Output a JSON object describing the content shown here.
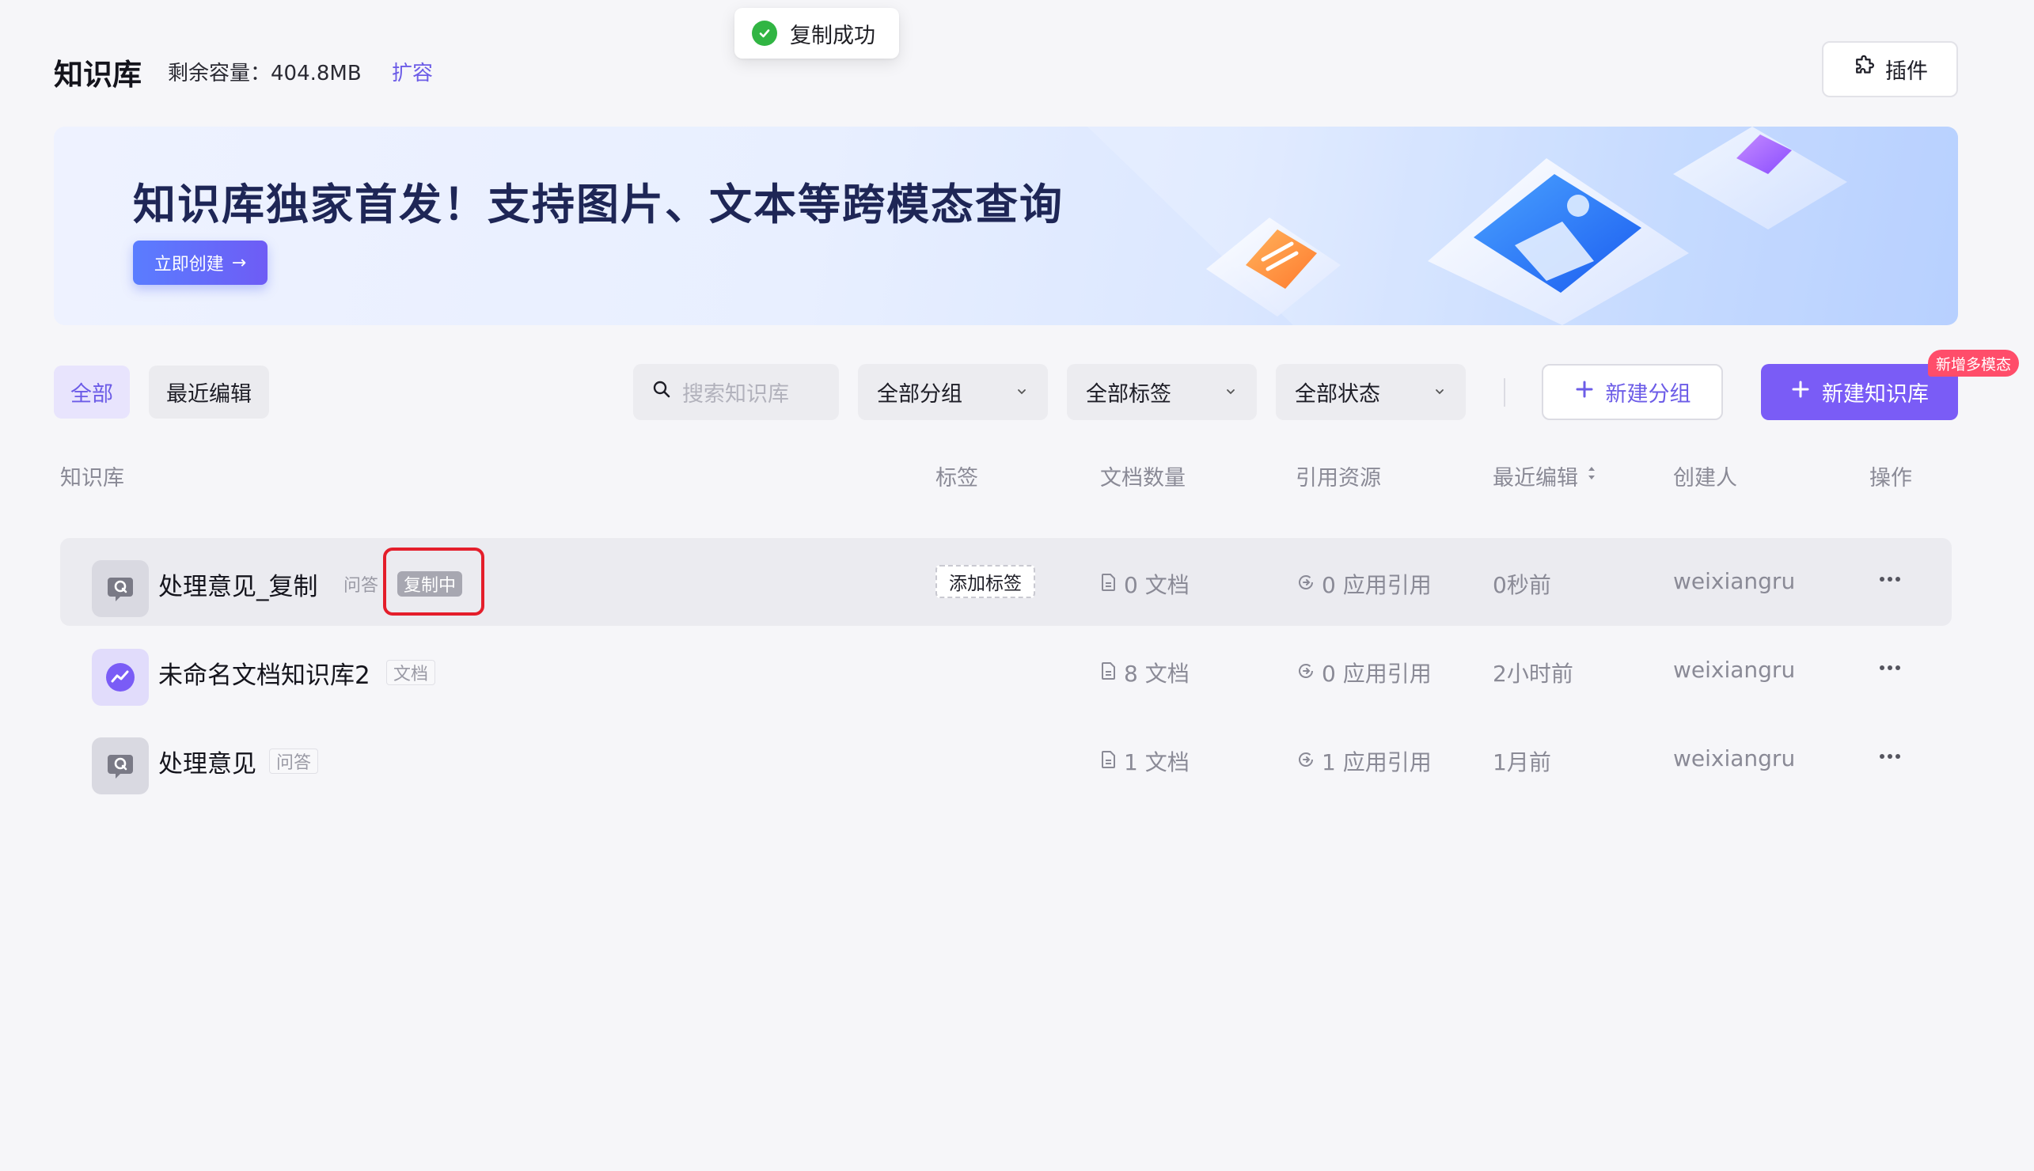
{
  "toast": {
    "message": "复制成功"
  },
  "header": {
    "title": "知识库",
    "capacity_label": "剩余容量：404.8MB",
    "expand_label": "扩容",
    "plugin_label": "插件"
  },
  "banner": {
    "headline": "知识库独家首发！支持图片、文本等跨模态查询",
    "cta_label": "立即创建",
    "cta_arrow": "→"
  },
  "toolbar": {
    "tabs": [
      {
        "label": "全部",
        "active": true
      },
      {
        "label": "最近编辑",
        "active": false
      }
    ],
    "search_placeholder": "搜索知识库",
    "filters": [
      {
        "value": "全部分组"
      },
      {
        "value": "全部标签"
      },
      {
        "value": "全部状态"
      }
    ],
    "new_group_label": "新建分组",
    "new_kb_label": "新建知识库",
    "new_kb_badge": "新增多模态"
  },
  "table": {
    "columns": [
      "知识库",
      "标签",
      "文档数量",
      "引用资源",
      "最近编辑",
      "创建人",
      "操作"
    ],
    "rows": [
      {
        "icon": "qa-icon",
        "name": "处理意见_复制",
        "type": "问答",
        "status": "复制中",
        "tag_action": "添加标签",
        "docs": "0 文档",
        "refs": "0 应用引用",
        "edited": "0秒前",
        "creator": "weixiangru"
      },
      {
        "icon": "doc-icon",
        "name": "未命名文档知识库2",
        "type": "文档",
        "docs": "8 文档",
        "refs": "0 应用引用",
        "edited": "2小时前",
        "creator": "weixiangru"
      },
      {
        "icon": "qa-icon",
        "name": "处理意见",
        "type": "问答",
        "docs": "1 文档",
        "refs": "1 应用引用",
        "edited": "1月前",
        "creator": "weixiangru"
      }
    ]
  },
  "colors": {
    "accent": "#6c5ce7",
    "primary_button": "#7a5cf6",
    "success": "#31b543",
    "highlight": "#e41e2b",
    "badge": "#ff4d6a"
  }
}
